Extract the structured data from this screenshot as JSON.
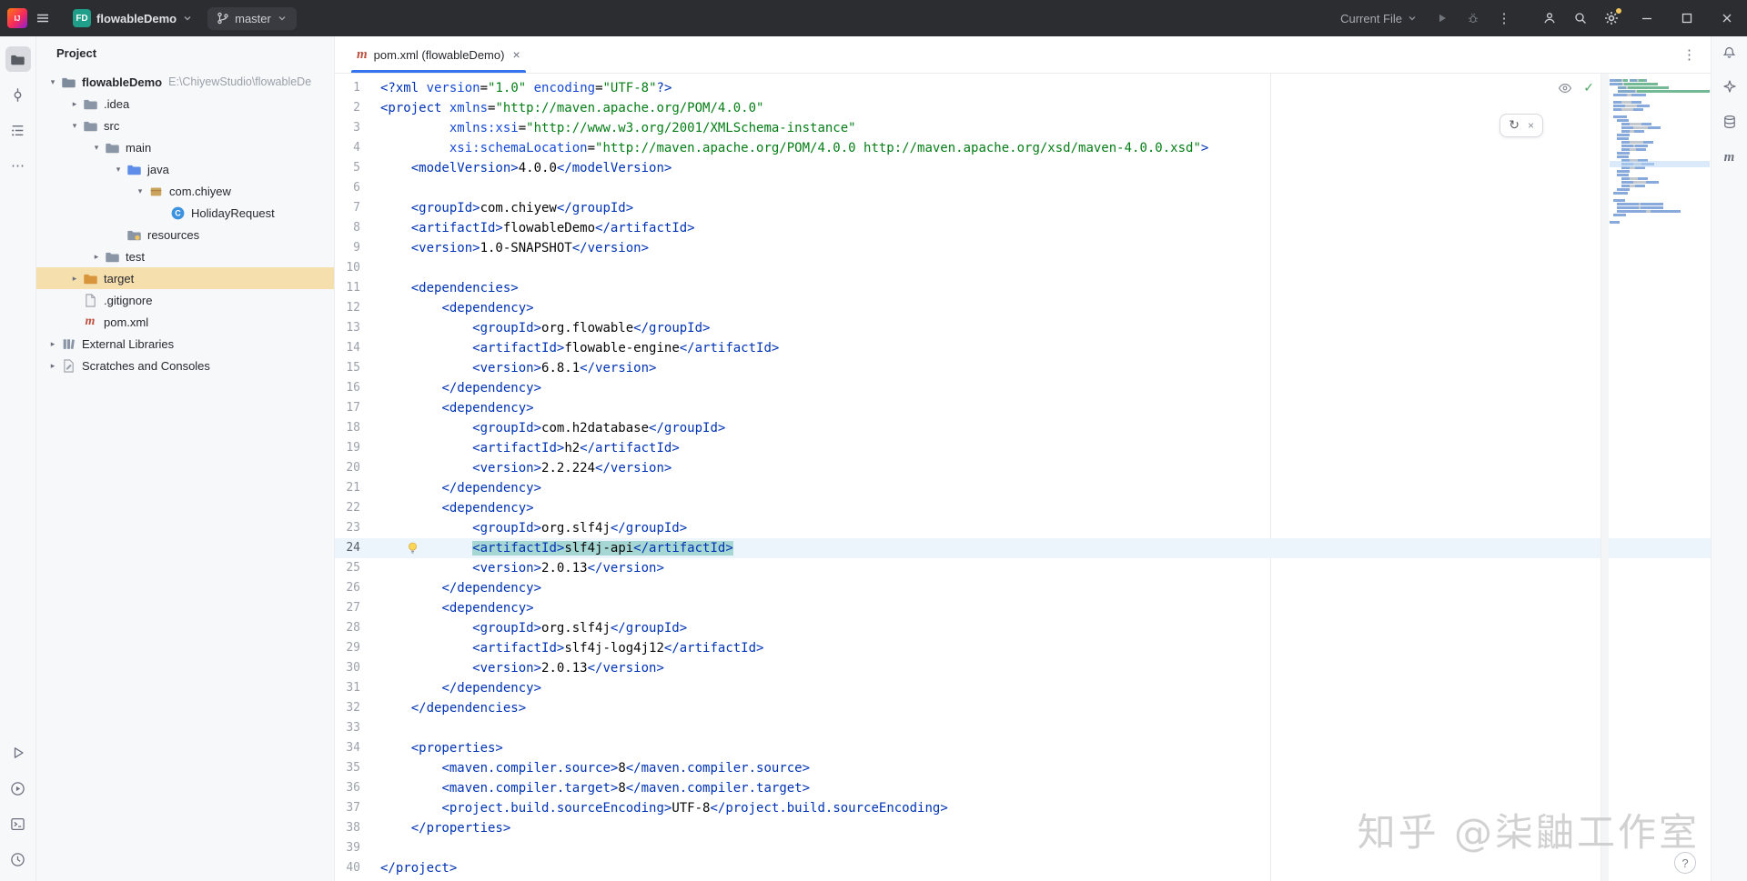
{
  "header": {
    "logo_text": "IJ",
    "project_badge": "FD",
    "project_name": "flowableDemo",
    "branch": "master",
    "run_config": "Current File"
  },
  "glyphs": {
    "maven": "m",
    "close": "×",
    "kebab": "⋮",
    "more": "⋯",
    "check": "✓",
    "reload": "↻",
    "question": "?",
    "chev_open": "▾",
    "chev_closed": "▸"
  },
  "left_toolbar": {
    "top_icons": [
      "project-folder",
      "commit",
      "structure",
      "more"
    ],
    "bottom_icons": [
      "run",
      "services",
      "terminal",
      "history"
    ]
  },
  "right_toolbar": {
    "icons": [
      "notifications-bell",
      "ai-star",
      "database",
      "maven"
    ]
  },
  "project_panel": {
    "title": "Project",
    "items": [
      {
        "level": 0,
        "state": "open",
        "icon": "project",
        "label": "flowableDemo",
        "suffix": "E:\\ChiyewStudio\\flowableDe",
        "bold": true
      },
      {
        "level": 1,
        "state": "closed",
        "icon": "folder",
        "label": ".idea"
      },
      {
        "level": 1,
        "state": "open",
        "icon": "folder",
        "label": "src"
      },
      {
        "level": 2,
        "state": "open",
        "icon": "folder",
        "label": "main"
      },
      {
        "level": 3,
        "state": "open",
        "icon": "folder-java",
        "label": "java"
      },
      {
        "level": 4,
        "state": "open",
        "icon": "package",
        "label": "com.chiyew"
      },
      {
        "level": 5,
        "state": "none",
        "icon": "class",
        "label": "HolidayRequest"
      },
      {
        "level": 3,
        "state": "none",
        "icon": "folder-resources",
        "label": "resources"
      },
      {
        "level": 2,
        "state": "closed",
        "icon": "folder",
        "label": "test"
      },
      {
        "level": 1,
        "state": "closed",
        "icon": "folder-target",
        "label": "target",
        "highlighted": true
      },
      {
        "level": 1,
        "state": "none",
        "icon": "file",
        "label": ".gitignore"
      },
      {
        "level": 1,
        "state": "none",
        "icon": "maven-file",
        "label": "pom.xml"
      },
      {
        "level": 0,
        "state": "closed",
        "icon": "library",
        "label": "External Libraries"
      },
      {
        "level": 0,
        "state": "closed",
        "icon": "scratch",
        "label": "Scratches and Consoles"
      }
    ]
  },
  "editor": {
    "tab": {
      "label": "pom.xml (flowableDemo)",
      "icon": "maven"
    },
    "caret_line": 24,
    "lines": [
      {
        "t": [
          [
            "tag",
            "<?xml "
          ],
          [
            "attr",
            "version"
          ],
          [
            "txt",
            "="
          ],
          [
            "str",
            "\"1.0\""
          ],
          [
            "txt",
            " "
          ],
          [
            "attr",
            "encoding"
          ],
          [
            "txt",
            "="
          ],
          [
            "str",
            "\"UTF-8\""
          ],
          [
            "tag",
            "?>"
          ]
        ]
      },
      {
        "t": [
          [
            "tag",
            "<project "
          ],
          [
            "attr",
            "xmlns"
          ],
          [
            "txt",
            "="
          ],
          [
            "str",
            "\"http://maven.apache.org/POM/4.0.0\""
          ]
        ]
      },
      {
        "t": [
          [
            "txt",
            "         "
          ],
          [
            "attr",
            "xmlns:xsi"
          ],
          [
            "txt",
            "="
          ],
          [
            "str",
            "\"http://www.w3.org/2001/XMLSchema-instance\""
          ]
        ]
      },
      {
        "t": [
          [
            "txt",
            "         "
          ],
          [
            "attr",
            "xsi:schemaLocation"
          ],
          [
            "txt",
            "="
          ],
          [
            "str",
            "\"http://maven.apache.org/POM/4.0.0 http://maven.apache.org/xsd/maven-4.0.0.xsd\""
          ],
          [
            "tag",
            ">"
          ]
        ]
      },
      {
        "t": [
          [
            "txt",
            "    "
          ],
          [
            "tag",
            "<modelVersion>"
          ],
          [
            "txt",
            "4.0.0"
          ],
          [
            "tag",
            "</modelVersion>"
          ]
        ]
      },
      {
        "t": []
      },
      {
        "t": [
          [
            "txt",
            "    "
          ],
          [
            "tag",
            "<groupId>"
          ],
          [
            "txt",
            "com.chiyew"
          ],
          [
            "tag",
            "</groupId>"
          ]
        ]
      },
      {
        "t": [
          [
            "txt",
            "    "
          ],
          [
            "tag",
            "<artifactId>"
          ],
          [
            "txt",
            "flowableDemo"
          ],
          [
            "tag",
            "</artifactId>"
          ]
        ]
      },
      {
        "t": [
          [
            "txt",
            "    "
          ],
          [
            "tag",
            "<version>"
          ],
          [
            "txt",
            "1.0-SNAPSHOT"
          ],
          [
            "tag",
            "</version>"
          ]
        ]
      },
      {
        "t": []
      },
      {
        "t": [
          [
            "txt",
            "    "
          ],
          [
            "tag",
            "<dependencies>"
          ]
        ]
      },
      {
        "t": [
          [
            "txt",
            "        "
          ],
          [
            "tag",
            "<dependency>"
          ]
        ]
      },
      {
        "t": [
          [
            "txt",
            "            "
          ],
          [
            "tag",
            "<groupId>"
          ],
          [
            "txt",
            "org.flowable"
          ],
          [
            "tag",
            "</groupId>"
          ]
        ]
      },
      {
        "t": [
          [
            "txt",
            "            "
          ],
          [
            "tag",
            "<artifactId>"
          ],
          [
            "txt",
            "flowable-engine"
          ],
          [
            "tag",
            "</artifactId>"
          ]
        ]
      },
      {
        "t": [
          [
            "txt",
            "            "
          ],
          [
            "tag",
            "<version>"
          ],
          [
            "txt",
            "6.8.1"
          ],
          [
            "tag",
            "</version>"
          ]
        ]
      },
      {
        "t": [
          [
            "txt",
            "        "
          ],
          [
            "tag",
            "</dependency>"
          ]
        ]
      },
      {
        "t": [
          [
            "txt",
            "        "
          ],
          [
            "tag",
            "<dependency>"
          ]
        ]
      },
      {
        "t": [
          [
            "txt",
            "            "
          ],
          [
            "tag",
            "<groupId>"
          ],
          [
            "txt",
            "com.h2database"
          ],
          [
            "tag",
            "</groupId>"
          ]
        ]
      },
      {
        "t": [
          [
            "txt",
            "            "
          ],
          [
            "tag",
            "<artifactId>"
          ],
          [
            "txt",
            "h2"
          ],
          [
            "tag",
            "</artifactId>"
          ]
        ]
      },
      {
        "t": [
          [
            "txt",
            "            "
          ],
          [
            "tag",
            "<version>"
          ],
          [
            "txt",
            "2.2.224"
          ],
          [
            "tag",
            "</version>"
          ]
        ]
      },
      {
        "t": [
          [
            "txt",
            "        "
          ],
          [
            "tag",
            "</dependency>"
          ]
        ]
      },
      {
        "t": [
          [
            "txt",
            "        "
          ],
          [
            "tag",
            "<dependency>"
          ]
        ]
      },
      {
        "t": [
          [
            "txt",
            "            "
          ],
          [
            "tag",
            "<groupId>"
          ],
          [
            "txt",
            "org.slf4j"
          ],
          [
            "tag",
            "</groupId>"
          ]
        ]
      },
      {
        "t": [
          [
            "txt",
            "            "
          ],
          [
            "tag",
            "<artifactId>",
            1
          ],
          [
            "txt",
            "slf4j-api",
            1
          ],
          [
            "tag",
            "</artifactId>",
            1
          ]
        ],
        "caret": true,
        "bulb": true
      },
      {
        "t": [
          [
            "txt",
            "            "
          ],
          [
            "tag",
            "<version>"
          ],
          [
            "txt",
            "2.0.13"
          ],
          [
            "tag",
            "</version>"
          ]
        ]
      },
      {
        "t": [
          [
            "txt",
            "        "
          ],
          [
            "tag",
            "</dependency>"
          ]
        ]
      },
      {
        "t": [
          [
            "txt",
            "        "
          ],
          [
            "tag",
            "<dependency>"
          ]
        ]
      },
      {
        "t": [
          [
            "txt",
            "            "
          ],
          [
            "tag",
            "<groupId>"
          ],
          [
            "txt",
            "org.slf4j"
          ],
          [
            "tag",
            "</groupId>"
          ]
        ]
      },
      {
        "t": [
          [
            "txt",
            "            "
          ],
          [
            "tag",
            "<artifactId>"
          ],
          [
            "txt",
            "slf4j-log4j12"
          ],
          [
            "tag",
            "</artifactId>"
          ]
        ]
      },
      {
        "t": [
          [
            "txt",
            "            "
          ],
          [
            "tag",
            "<version>"
          ],
          [
            "txt",
            "2.0.13"
          ],
          [
            "tag",
            "</version>"
          ]
        ]
      },
      {
        "t": [
          [
            "txt",
            "        "
          ],
          [
            "tag",
            "</dependency>"
          ]
        ]
      },
      {
        "t": [
          [
            "txt",
            "    "
          ],
          [
            "tag",
            "</dependencies>"
          ]
        ]
      },
      {
        "t": []
      },
      {
        "t": [
          [
            "txt",
            "    "
          ],
          [
            "tag",
            "<properties>"
          ]
        ]
      },
      {
        "t": [
          [
            "txt",
            "        "
          ],
          [
            "tag",
            "<maven.compiler.source>"
          ],
          [
            "txt",
            "8"
          ],
          [
            "tag",
            "</maven.compiler.source>"
          ]
        ]
      },
      {
        "t": [
          [
            "txt",
            "        "
          ],
          [
            "tag",
            "<maven.compiler.target>"
          ],
          [
            "txt",
            "8"
          ],
          [
            "tag",
            "</maven.compiler.target>"
          ]
        ]
      },
      {
        "t": [
          [
            "txt",
            "        "
          ],
          [
            "tag",
            "<project.build.sourceEncoding>"
          ],
          [
            "txt",
            "UTF-8"
          ],
          [
            "tag",
            "</project.build.sourceEncoding>"
          ]
        ]
      },
      {
        "t": [
          [
            "txt",
            "    "
          ],
          [
            "tag",
            "</properties>"
          ]
        ]
      },
      {
        "t": []
      },
      {
        "t": [
          [
            "tag",
            "</project>"
          ]
        ]
      }
    ]
  },
  "widgets": {
    "inspections_status": "no-problems"
  },
  "watermark": "知乎 @柒鼬工作室",
  "colors": {
    "accent": "#3574F0",
    "header_bg": "#2B2D30",
    "selection": "#A6D7D4",
    "caret_line_bg": "#EDF5FC",
    "xml_tag": "#0033B3",
    "xml_attribute": "#174AD4",
    "xml_string": "#067D17",
    "xml_text": "#080808",
    "target_row_bg": "#F5DFAD",
    "check_green": "#4CA663",
    "bulb_yellow": "#FDD75A",
    "project_badge_bg": "#1F9E89"
  }
}
